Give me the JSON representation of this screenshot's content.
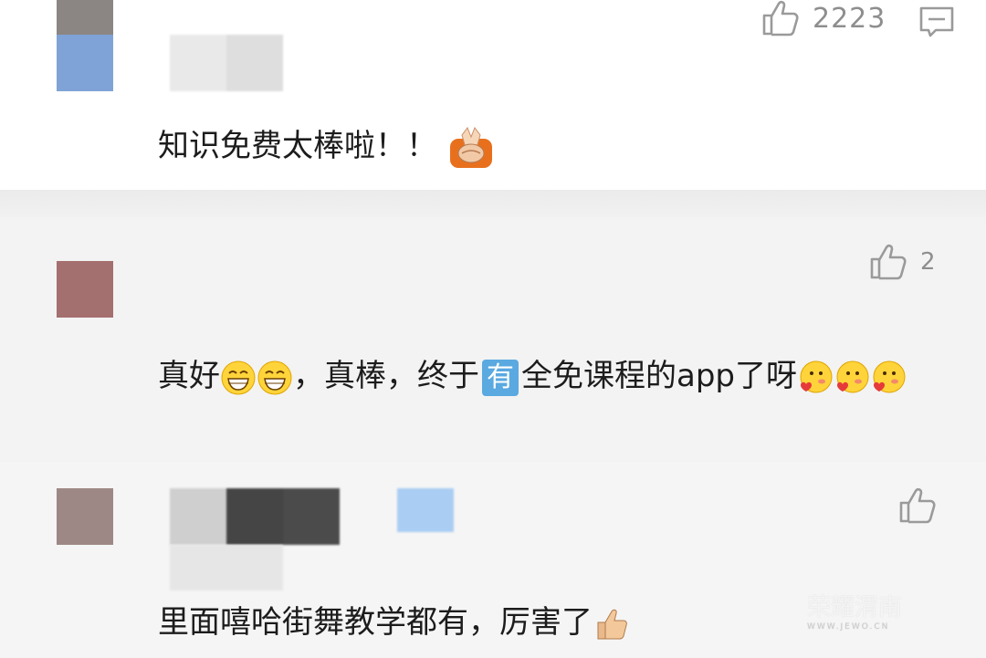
{
  "comments": [
    {
      "avatar_colors": [
        "#8b8583",
        "#7fa3d6"
      ],
      "likes": "2223",
      "text": "知识免费太棒啦！！",
      "emojis": [
        "hands-together-emoji"
      ]
    },
    {
      "avatar_colors": [
        "#a46f6f"
      ],
      "likes": "2",
      "text_part1": "真好",
      "text_part2": "，真棒，终于",
      "tag": "有",
      "text_part3": "全免课程的app了呀",
      "emojis": [
        "grin-emoji",
        "blush-heart-emoji"
      ]
    },
    {
      "avatar_colors": [
        "#9e8885"
      ],
      "likes": "",
      "text": "里面嘻哈街舞教学都有，厉害了",
      "emojis": [
        "thumbs-up-emoji"
      ]
    }
  ],
  "watermark": {
    "line1": "荣耀渭南",
    "line2": "WWW.JEWO.CN"
  },
  "colors": {
    "icon_gray": "#9a9a9a",
    "tag_blue": "#5aa9e0"
  }
}
